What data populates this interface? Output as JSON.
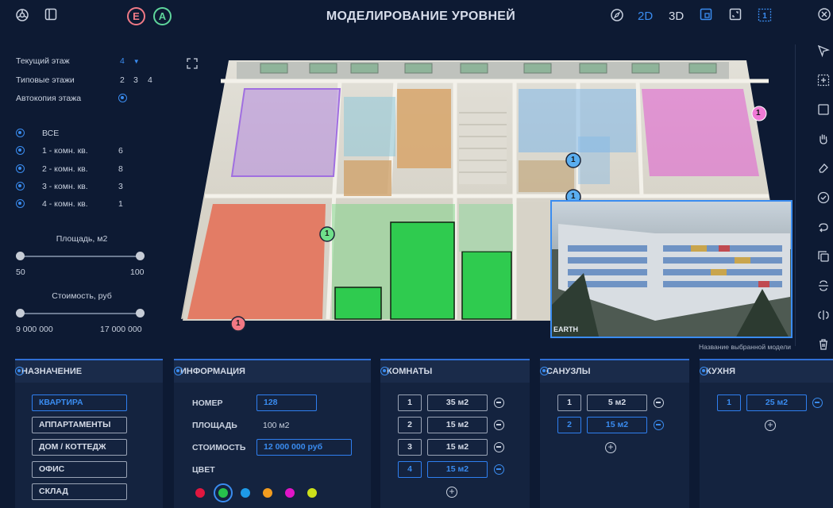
{
  "header": {
    "title": "МОДЕЛИРОВАНИЕ УРОВНЕЙ",
    "badge_e": "E",
    "badge_a": "A",
    "mode_2d": "2D",
    "mode_3d": "3D"
  },
  "filters": {
    "current_floor_label": "Текущий этаж",
    "current_floor_value": "4",
    "typical_floors_label": "Типовые этажи",
    "typical_floors": [
      "2",
      "3",
      "4"
    ],
    "autocopy_label": "Автокопия этажа",
    "apt_types": [
      {
        "label": "ВСЕ",
        "count": ""
      },
      {
        "label": "1 - комн. кв.",
        "count": "6"
      },
      {
        "label": "2 - комн. кв.",
        "count": "8"
      },
      {
        "label": "3 - комн. кв.",
        "count": "3"
      },
      {
        "label": "4 - комн. кв.",
        "count": "1"
      }
    ],
    "area": {
      "label": "Площадь, м2",
      "min": "50",
      "max": "100"
    },
    "price": {
      "label": "Стоимость, руб",
      "min": "9 000 000",
      "max": "17 000 000"
    }
  },
  "viewport": {
    "markers": [
      "1",
      "1",
      "1",
      "1",
      "1"
    ],
    "preview_caption": "Название выбранной модели",
    "preview_watermark": "EARTH"
  },
  "panels": {
    "purpose": {
      "title": "НАЗНАЧЕНИЕ",
      "options": [
        "КВАРТИРА",
        "АППАРТАМЕНТЫ",
        "ДОМ / КОТТЕДЖ",
        "ОФИС",
        "СКЛАД"
      ],
      "selected_index": 0
    },
    "info": {
      "title": "ИНФОРМАЦИЯ",
      "number_label": "НОМЕР",
      "number_value": "128",
      "area_label": "ПЛОЩАДЬ",
      "area_value": "100 м2",
      "price_label": "СТОИМОСТЬ",
      "price_value": "12 000 000 руб",
      "color_label": "ЦВЕТ",
      "colors": [
        "#e0173f",
        "#27c24c",
        "#1e9be8",
        "#f29c1f",
        "#e015c7",
        "#cde01a"
      ],
      "selected_color_index": 1
    },
    "rooms": {
      "title": "КОМНАТЫ",
      "rows": [
        {
          "n": "1",
          "area": "35 м2",
          "sel": false
        },
        {
          "n": "2",
          "area": "15 м2",
          "sel": false
        },
        {
          "n": "3",
          "area": "15 м2",
          "sel": false
        },
        {
          "n": "4",
          "area": "15 м2",
          "sel": true
        }
      ]
    },
    "bathrooms": {
      "title": "САНУЗЛЫ",
      "rows": [
        {
          "n": "1",
          "area": "5 м2",
          "sel": false
        },
        {
          "n": "2",
          "area": "15 м2",
          "sel": true
        }
      ]
    },
    "kitchen": {
      "title": "КУХНЯ",
      "rows": [
        {
          "n": "1",
          "area": "25 м2",
          "sel": true
        }
      ]
    }
  },
  "colors": {
    "accent": "#2f7ff0",
    "background": "#0d1a33",
    "panel": "#14233f"
  }
}
